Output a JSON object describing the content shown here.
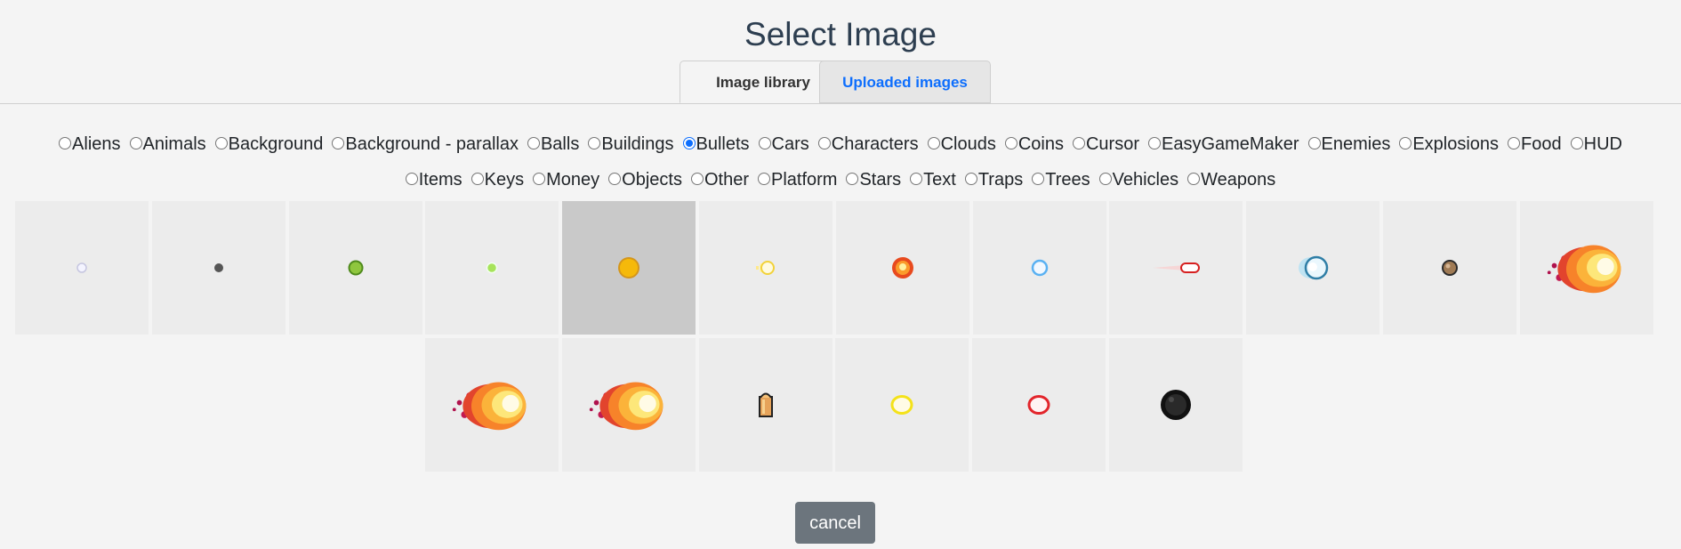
{
  "dialog": {
    "title": "Select Image"
  },
  "tabs": [
    {
      "label": "Image library",
      "active": true
    },
    {
      "label": "Uploaded images",
      "active": false
    }
  ],
  "categories_row1": [
    "Aliens",
    "Animals",
    "Background",
    "Background - parallax",
    "Balls",
    "Buildings",
    "Bullets",
    "Cars",
    "Characters",
    "Clouds",
    "Coins",
    "Cursor",
    "EasyGameMaker",
    "Enemies",
    "Explosions",
    "Food",
    "HUD"
  ],
  "categories_row2": [
    "Items",
    "Keys",
    "Money",
    "Objects",
    "Other",
    "Platform",
    "Stars",
    "Text",
    "Traps",
    "Trees",
    "Vehicles",
    "Weapons"
  ],
  "selected_category": "Bullets",
  "images": [
    "small-light-bullet-icon",
    "small-gray-bullet-icon",
    "green-bullet-icon",
    "small-green-bullet-icon",
    "yellow-bullet-icon",
    "yellow-energy-bullet-icon",
    "orange-fireball-icon",
    "blue-ring-bullet-icon",
    "red-laser-bullet-icon",
    "blue-plasma-bullet-icon",
    "brown-bullet-icon",
    "large-fireball-icon",
    "large-fireball-icon",
    "large-fireball-icon",
    "rifle-cartridge-icon",
    "yellow-ring-bullet-icon",
    "red-ring-bullet-icon",
    "black-cannonball-icon"
  ],
  "selected_image_index": 4,
  "cancel_label": "cancel"
}
